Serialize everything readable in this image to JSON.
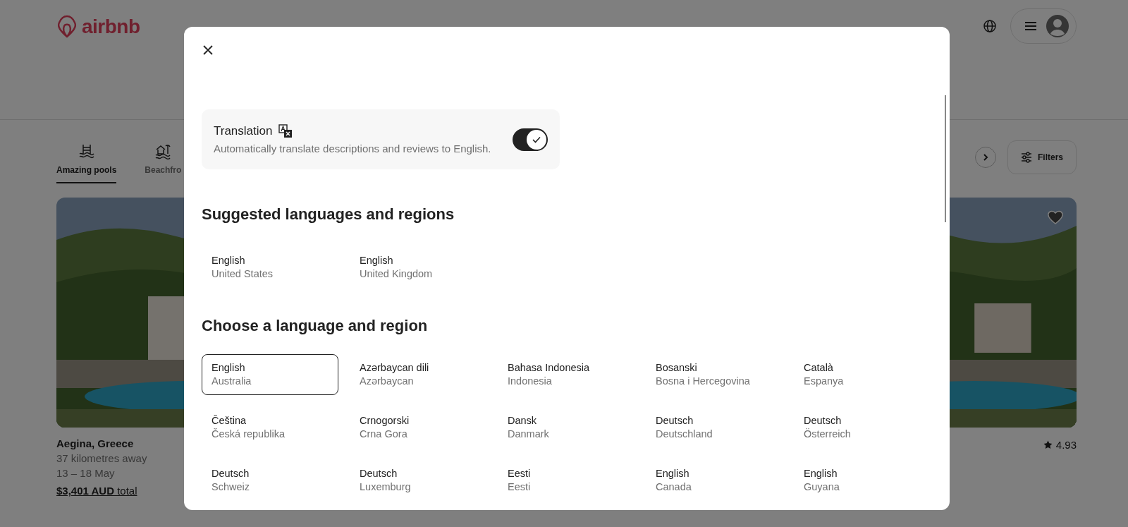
{
  "header": {
    "logo": "airbnb"
  },
  "categories": [
    {
      "label": "Amazing pools",
      "selected": true
    },
    {
      "label": "Beachfro",
      "selected": false
    }
  ],
  "filters_button": "Filters",
  "listings": [
    {
      "kind": "details",
      "title": "Aegina, Greece",
      "distance": "37 kilometres away",
      "dates": "13 – 18 May",
      "price": "**$3,401 AUD** total"
    },
    {
      "kind": "rating",
      "rating": "4.93"
    }
  ],
  "dialog": {
    "translation": {
      "title": "Translation",
      "description": "Automatically translate descriptions and reviews to English.",
      "on": true
    },
    "suggested": {
      "heading": "Suggested languages and regions",
      "items": [
        {
          "language": "English",
          "region": "United States"
        },
        {
          "language": "English",
          "region": "United Kingdom"
        }
      ]
    },
    "choose": {
      "heading": "Choose a language and region",
      "items": [
        {
          "language": "English",
          "region": "Australia",
          "selected": true
        },
        {
          "language": "Azərbaycan dili",
          "region": "Azərbaycan",
          "selected": false
        },
        {
          "language": "Bahasa Indonesia",
          "region": "Indonesia",
          "selected": false
        },
        {
          "language": "Bosanski",
          "region": "Bosna i Hercegovina",
          "selected": false
        },
        {
          "language": "Català",
          "region": "Espanya",
          "selected": false
        },
        {
          "language": "Čeština",
          "region": "Česká republika",
          "selected": false
        },
        {
          "language": "Crnogorski",
          "region": "Crna Gora",
          "selected": false
        },
        {
          "language": "Dansk",
          "region": "Danmark",
          "selected": false
        },
        {
          "language": "Deutsch",
          "region": "Deutschland",
          "selected": false
        },
        {
          "language": "Deutsch",
          "region": "Österreich",
          "selected": false
        },
        {
          "language": "Deutsch",
          "region": "Schweiz",
          "selected": false
        },
        {
          "language": "Deutsch",
          "region": "Luxemburg",
          "selected": false
        },
        {
          "language": "Eesti",
          "region": "Eesti",
          "selected": false
        },
        {
          "language": "English",
          "region": "Canada",
          "selected": false
        },
        {
          "language": "English",
          "region": "Guyana",
          "selected": false
        }
      ]
    }
  }
}
